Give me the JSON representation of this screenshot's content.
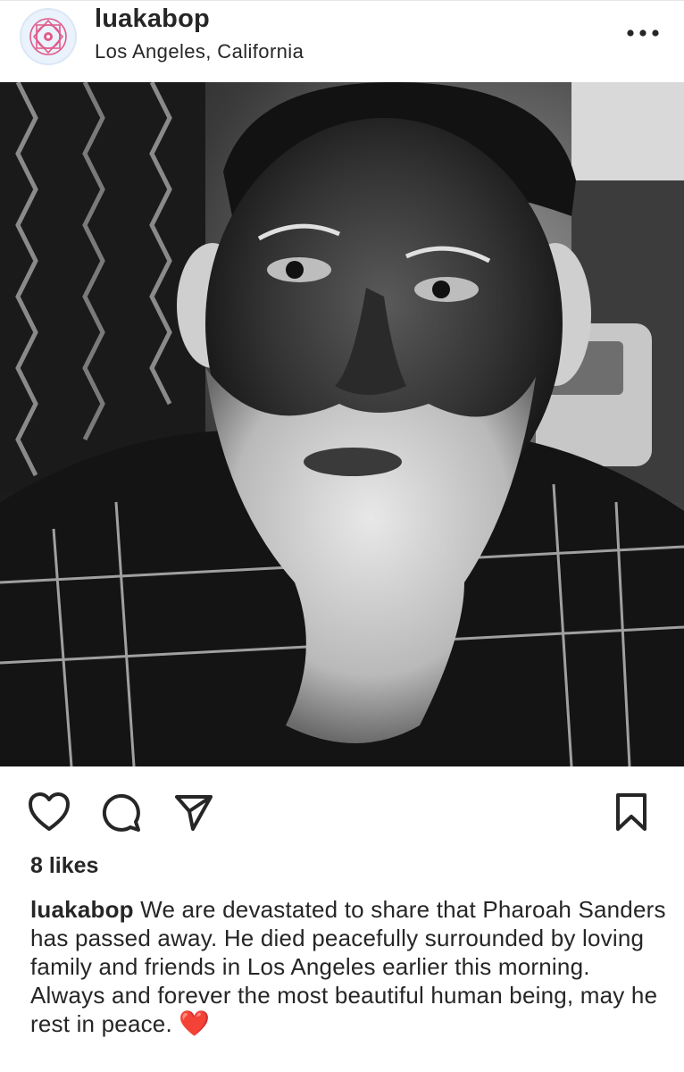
{
  "post": {
    "username": "luakabop",
    "location": "Los Angeles, California",
    "likes": "8 likes",
    "caption_username": "luakabop",
    "caption_text": "We are devastated to share that Pharoah Sanders has passed away. He died peacefully surrounded by loving family and friends in Los Angeles earlier this morning. Always and forever the most beautiful human being, may he rest in peace.",
    "caption_emoji": "❤️"
  },
  "icons": {
    "avatar": "mandala-logo",
    "more": "more-dots-icon",
    "like": "heart-outline-icon",
    "comment": "comment-bubble-icon",
    "share": "paper-plane-icon",
    "save": "bookmark-icon"
  },
  "colors": {
    "text": "#262626",
    "avatar_accent": "#e05a8a",
    "avatar_bg": "#eaf2fb",
    "heart_emoji": "#e0282e"
  }
}
